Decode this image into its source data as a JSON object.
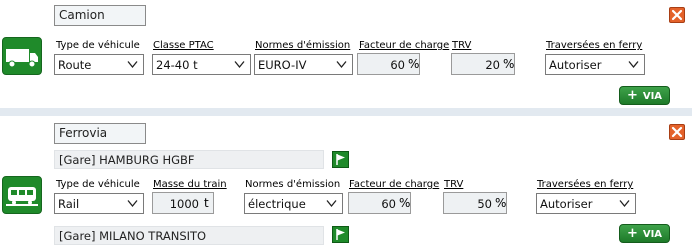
{
  "truck": {
    "name_value": "Camion",
    "labels": {
      "vehicle_type": "Type de véhicule",
      "weight_class": "Classe PTAC",
      "emission_norm": "Normes d'émission",
      "load_factor": "Facteur de charge",
      "trv": "TRV",
      "ferry": "Traversées en ferry"
    },
    "vehicle_type": "Route",
    "weight_class": "24-40 t",
    "emission_norm": "EURO-IV",
    "load_factor": "60",
    "trv": "20",
    "ferry": "Autoriser",
    "percent": "%",
    "via_label": "VIA"
  },
  "rail": {
    "name_value": "Ferrovia",
    "origin_station": "[Gare] HAMBURG HGBF",
    "destination_station": "[Gare] MILANO TRANSITO",
    "labels": {
      "vehicle_type": "Type de véhicule",
      "train_mass": "Masse du train",
      "emission_norm": "Normes d'émission",
      "load_factor": "Facteur de charge",
      "trv": "TRV",
      "ferry": "Traversées en ferry"
    },
    "vehicle_type": "Rail",
    "train_mass": "1000",
    "mass_unit": "t",
    "emission_norm": "électrique",
    "load_factor": "60",
    "trv": "50",
    "ferry": "Autoriser",
    "percent": "%",
    "via_label": "VIA"
  },
  "colors": {
    "accent_green": "#1f8a2a",
    "close_orange": "#e4622a",
    "separator": "#e2e9f0"
  }
}
